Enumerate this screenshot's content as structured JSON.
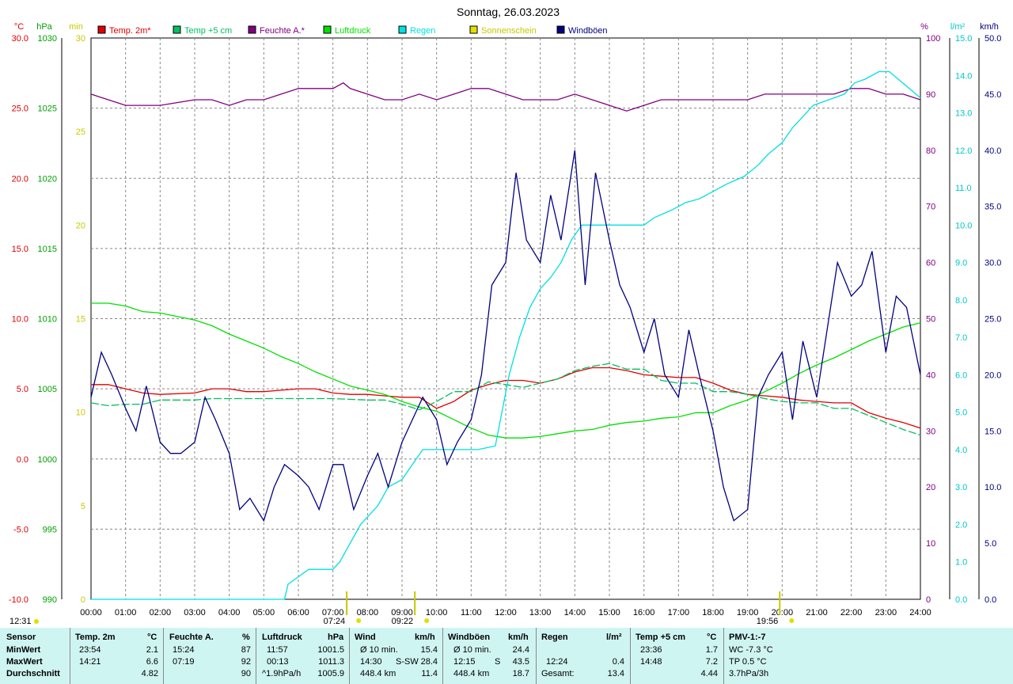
{
  "chart_data": {
    "type": "line",
    "title": "Sonntag, 26.03.2023",
    "x_ticks": [
      "00:00",
      "01:00",
      "02:00",
      "03:00",
      "04:00",
      "05:00",
      "06:00",
      "07:00",
      "08:00",
      "09:00",
      "10:00",
      "11:00",
      "12:00",
      "13:00",
      "14:00",
      "15:00",
      "16:00",
      "17:00",
      "18:00",
      "19:00",
      "20:00",
      "21:00",
      "22:00",
      "23:00",
      "24:00"
    ],
    "axes": {
      "temp_c": {
        "unit": "°C",
        "color": "#e00000",
        "min": -10,
        "max": 30,
        "ticks": [
          "30.0",
          "25.0",
          "20.0",
          "15.0",
          "10.0",
          "5.0",
          "0.0",
          "-5.0",
          "-10.0"
        ]
      },
      "pressure_hpa": {
        "unit": "hPa",
        "color": "#00a000",
        "min": 990,
        "max": 1030,
        "ticks": [
          "1030",
          "1025",
          "1020",
          "1015",
          "1010",
          "1005",
          "1000",
          "995",
          "990"
        ]
      },
      "sun_min": {
        "unit": "min",
        "color": "#e0e000",
        "min": 0,
        "max": 30,
        "ticks": [
          "30",
          "25",
          "20",
          "15",
          "10",
          "5",
          "0"
        ]
      },
      "humidity_pct": {
        "unit": "%",
        "color": "#800080",
        "min": 0,
        "max": 100,
        "ticks": [
          "100",
          "90",
          "80",
          "70",
          "60",
          "50",
          "40",
          "30",
          "20",
          "10",
          "0"
        ]
      },
      "rain_lm2": {
        "unit": "l/m²",
        "color": "#00e0e0",
        "min": 0,
        "max": 15,
        "ticks": [
          "15.0",
          "14.0",
          "13.0",
          "12.0",
          "11.0",
          "10.0",
          "9.0",
          "8.0",
          "7.0",
          "6.0",
          "5.0",
          "4.0",
          "3.0",
          "2.0",
          "1.0",
          "0.0"
        ]
      },
      "gust_kmh": {
        "unit": "km/h",
        "color": "#000080",
        "min": 0,
        "max": 50,
        "ticks": [
          "50.0",
          "45.0",
          "40.0",
          "35.0",
          "30.0",
          "25.0",
          "20.0",
          "15.0",
          "10.0",
          "5.0",
          "0.0"
        ]
      }
    },
    "legend": [
      {
        "name": "Temp. 2m*",
        "color": "#e00000"
      },
      {
        "name": "Temp +5 cm",
        "color": "#00c060"
      },
      {
        "name": "Feuchte A.*",
        "color": "#800080"
      },
      {
        "name": "Luftdruck",
        "color": "#00e000"
      },
      {
        "name": "Regen",
        "color": "#00e0e0"
      },
      {
        "name": "Sonnenschein",
        "color": "#e0e000"
      },
      {
        "name": "Windböen",
        "color": "#000080"
      }
    ],
    "series": [
      {
        "name": "Temp. 2m*",
        "axis": "temp_c",
        "x": [
          0,
          0.5,
          1,
          1.5,
          2,
          3,
          3.5,
          4,
          4.5,
          5,
          5.5,
          6,
          6.5,
          7,
          7.5,
          8,
          8.5,
          9,
          9.5,
          10,
          10.5,
          11,
          11.5,
          12,
          12.5,
          13,
          13.5,
          14,
          14.5,
          15,
          15.5,
          16,
          16.5,
          17,
          17.5,
          18,
          18.5,
          19,
          19.5,
          20,
          20.5,
          21,
          21.5,
          22,
          22.5,
          23,
          23.5,
          24
        ],
        "values": [
          5.3,
          5.3,
          5.0,
          4.7,
          4.6,
          4.7,
          5.0,
          5.0,
          4.8,
          4.8,
          4.9,
          5.0,
          5.0,
          4.7,
          4.6,
          4.6,
          4.5,
          4.4,
          4.4,
          3.6,
          4.1,
          4.9,
          5.3,
          5.6,
          5.6,
          5.4,
          5.7,
          6.2,
          6.5,
          6.5,
          6.3,
          6.0,
          5.9,
          5.8,
          5.8,
          5.4,
          4.9,
          4.6,
          4.5,
          4.4,
          4.2,
          4.1,
          4.0,
          4.0,
          3.3,
          2.9,
          2.6,
          2.2
        ]
      },
      {
        "name": "Temp +5 cm",
        "axis": "temp_c",
        "x": [
          0,
          0.5,
          1,
          1.5,
          2,
          3,
          3.5,
          4,
          5,
          6,
          7,
          8,
          8.5,
          9,
          9.5,
          10,
          10.5,
          11,
          11.5,
          12,
          12.5,
          13,
          13.5,
          14,
          14.5,
          15,
          15.5,
          16,
          16.5,
          17,
          17.5,
          18,
          18.5,
          19,
          19.5,
          20,
          20.5,
          21,
          21.5,
          22,
          22.5,
          23,
          23.5,
          24
        ],
        "values": [
          4.0,
          3.8,
          3.9,
          3.9,
          4.2,
          4.2,
          4.3,
          4.3,
          4.3,
          4.3,
          4.3,
          4.2,
          4.2,
          3.9,
          3.5,
          4.1,
          4.8,
          4.8,
          5.5,
          5.3,
          5.1,
          5.4,
          5.7,
          6.3,
          6.6,
          6.8,
          6.4,
          6.4,
          5.6,
          5.4,
          5.4,
          4.8,
          4.8,
          4.6,
          4.3,
          4.1,
          4.0,
          4.0,
          3.6,
          3.6,
          3.1,
          2.6,
          2.1,
          1.7
        ]
      },
      {
        "name": "Feuchte A.*",
        "axis": "humidity_pct",
        "x": [
          0,
          0.5,
          1,
          1.5,
          2,
          3,
          3.5,
          4,
          4.5,
          5,
          5.5,
          6,
          6.5,
          7,
          7.3,
          7.5,
          8,
          8.5,
          9,
          9.5,
          10,
          10.5,
          11,
          11.5,
          12,
          12.5,
          13,
          13.5,
          14,
          14.5,
          15,
          15.5,
          16,
          16.5,
          17,
          17.5,
          18,
          18.5,
          19,
          19.5,
          20,
          20.5,
          21,
          21.5,
          22,
          22.5,
          23,
          23.5,
          24
        ],
        "values": [
          90,
          89,
          88,
          88,
          88,
          89,
          89,
          88,
          89,
          89,
          90,
          91,
          91,
          91,
          92,
          91,
          90,
          89,
          89,
          90,
          89,
          90,
          91,
          91,
          90,
          89,
          89,
          89,
          90,
          89,
          88,
          87,
          88,
          89,
          89,
          89,
          89,
          89,
          89,
          90,
          90,
          90,
          90,
          90,
          91,
          91,
          90,
          90,
          89
        ]
      },
      {
        "name": "Luftdruck",
        "axis": "pressure_hpa",
        "x": [
          0,
          0.5,
          1,
          1.5,
          2,
          3,
          3.5,
          4,
          4.5,
          5,
          5.5,
          6,
          6.5,
          7,
          7.5,
          8,
          8.5,
          9,
          9.5,
          10,
          10.5,
          11,
          11.5,
          12,
          12.5,
          13,
          13.5,
          14,
          14.5,
          15,
          15.5,
          16,
          16.5,
          17,
          17.5,
          18,
          18.5,
          19,
          19.5,
          20,
          20.5,
          21,
          21.5,
          22,
          22.5,
          23,
          23.5,
          24
        ],
        "values": [
          1011.1,
          1011.1,
          1010.9,
          1010.5,
          1010.4,
          1009.9,
          1009.5,
          1008.9,
          1008.4,
          1007.9,
          1007.3,
          1006.8,
          1006.2,
          1005.7,
          1005.2,
          1004.9,
          1004.6,
          1004.1,
          1003.7,
          1003.4,
          1002.8,
          1002.2,
          1001.7,
          1001.5,
          1001.5,
          1001.6,
          1001.8,
          1002.0,
          1002.1,
          1002.4,
          1002.6,
          1002.7,
          1002.9,
          1003.0,
          1003.3,
          1003.3,
          1003.8,
          1004.2,
          1004.8,
          1005.4,
          1006.1,
          1006.7,
          1007.2,
          1007.8,
          1008.4,
          1008.9,
          1009.4,
          1009.7
        ]
      },
      {
        "name": "Regen",
        "axis": "rain_lm2",
        "x": [
          0,
          5.6,
          5.7,
          6.0,
          6.3,
          7.0,
          7.2,
          7.5,
          7.8,
          8.3,
          8.6,
          9.0,
          9.3,
          9.6,
          10.0,
          10.3,
          10.8,
          11.2,
          11.7,
          12.1,
          12.4,
          12.7,
          13.0,
          13.3,
          13.6,
          13.9,
          14.2,
          14.6,
          15.0,
          15.5,
          16.0,
          16.3,
          16.8,
          17.2,
          17.6,
          18.0,
          18.4,
          18.9,
          19.3,
          19.6,
          20.0,
          20.3,
          20.6,
          20.9,
          21.2,
          21.5,
          21.8,
          22.1,
          22.4,
          22.8,
          23.1,
          24
        ],
        "values": [
          0,
          0,
          0.4,
          0.6,
          0.8,
          0.8,
          1.0,
          1.5,
          2.0,
          2.5,
          3.0,
          3.2,
          3.6,
          4.0,
          4.0,
          4.0,
          4.0,
          4.0,
          4.1,
          6.0,
          7.0,
          7.8,
          8.3,
          8.6,
          9.0,
          9.6,
          10.0,
          10.0,
          10.0,
          10.0,
          10.0,
          10.2,
          10.4,
          10.6,
          10.7,
          10.9,
          11.1,
          11.3,
          11.6,
          11.9,
          12.2,
          12.6,
          12.9,
          13.2,
          13.3,
          13.4,
          13.5,
          13.8,
          13.9,
          14.1,
          14.1,
          13.4
        ]
      },
      {
        "name": "Windböen",
        "axis": "gust_kmh",
        "x": [
          0,
          0.3,
          0.6,
          1,
          1.3,
          1.6,
          2,
          2.3,
          2.6,
          3,
          3.3,
          3.6,
          4,
          4.3,
          4.6,
          5,
          5.3,
          5.6,
          6,
          6.3,
          6.6,
          7,
          7.3,
          7.6,
          8,
          8.3,
          8.6,
          9,
          9.3,
          9.6,
          10,
          10.3,
          10.6,
          11,
          11.3,
          11.6,
          12,
          12.3,
          12.6,
          13,
          13.3,
          13.6,
          14,
          14.3,
          14.6,
          15,
          15.3,
          15.6,
          16,
          16.3,
          16.6,
          17,
          17.3,
          17.6,
          18,
          18.3,
          18.6,
          19,
          19.3,
          19.6,
          20,
          20.3,
          20.6,
          21,
          21.3,
          21.6,
          22,
          22.3,
          22.6,
          23,
          23.3,
          23.6,
          24
        ],
        "values": [
          18,
          22,
          20,
          17,
          15,
          19,
          14,
          13,
          13,
          14,
          18,
          16,
          13,
          8,
          9,
          7,
          10,
          12,
          11,
          10,
          8,
          12,
          12,
          8,
          11,
          13,
          10,
          14,
          16,
          18,
          16,
          12,
          14,
          16,
          20,
          28,
          30,
          38,
          32,
          30,
          36,
          32,
          40,
          28,
          38,
          32,
          28,
          26,
          22,
          25,
          20,
          18,
          24,
          20,
          15,
          10,
          7,
          8,
          18,
          20,
          22,
          16,
          23,
          18,
          24,
          30,
          27,
          28,
          31,
          22,
          27,
          26,
          20
        ]
      }
    ],
    "sun_markers": [
      {
        "label": "07:24"
      },
      {
        "label": "09:22"
      },
      {
        "label": "19:56"
      }
    ],
    "sun_left": "12:31"
  },
  "stats": {
    "columns": [
      {
        "header": "Sensor",
        "rows": [
          "MinWert",
          "MaxWert",
          "Durchschnitt"
        ]
      },
      {
        "header": "Temp. 2m",
        "unit": "°C",
        "rows": [
          [
            "23:54",
            "2.1"
          ],
          [
            "14:21",
            "6.6"
          ],
          [
            "",
            "4.82"
          ]
        ]
      },
      {
        "header": "Feuchte A.",
        "unit": "%",
        "rows": [
          [
            "15:24",
            "87"
          ],
          [
            "07:19",
            "92"
          ],
          [
            "",
            "90"
          ]
        ]
      },
      {
        "header": "Luftdruck",
        "unit": "hPa",
        "rows": [
          [
            "11:57",
            "1001.5"
          ],
          [
            "00:13",
            "1011.3"
          ],
          [
            "^1.9hPa/h",
            "1005.9"
          ]
        ]
      },
      {
        "header": "Wind",
        "unit": "km/h",
        "rows": [
          [
            "Ø 10 min.",
            "",
            "15.4"
          ],
          [
            "14:30",
            "S-SW",
            "28.4"
          ],
          [
            "448.4 km",
            "",
            "11.4"
          ]
        ]
      },
      {
        "header": "Windböen",
        "unit": "km/h",
        "rows": [
          [
            "Ø 10 min.",
            "",
            "24.4"
          ],
          [
            "12:15",
            "S",
            "43.5"
          ],
          [
            "448.4 km",
            "",
            "18.7"
          ]
        ]
      },
      {
        "header": "Regen",
        "unit": "l/m²",
        "rows": [
          [
            "",
            ""
          ],
          [
            "12:24",
            "0.4"
          ],
          [
            "Gesamt:",
            "13.4"
          ]
        ]
      },
      {
        "header": "Temp +5 cm",
        "unit": "°C",
        "rows": [
          [
            "23:36",
            "1.7"
          ],
          [
            "14:48",
            "7.2"
          ],
          [
            "",
            "4.44"
          ]
        ]
      },
      {
        "header": "PMV-1:-7",
        "rows": [
          "WC -7.3 °C",
          "TP 0.5 °C",
          "3.7hPa/3h"
        ]
      }
    ]
  }
}
